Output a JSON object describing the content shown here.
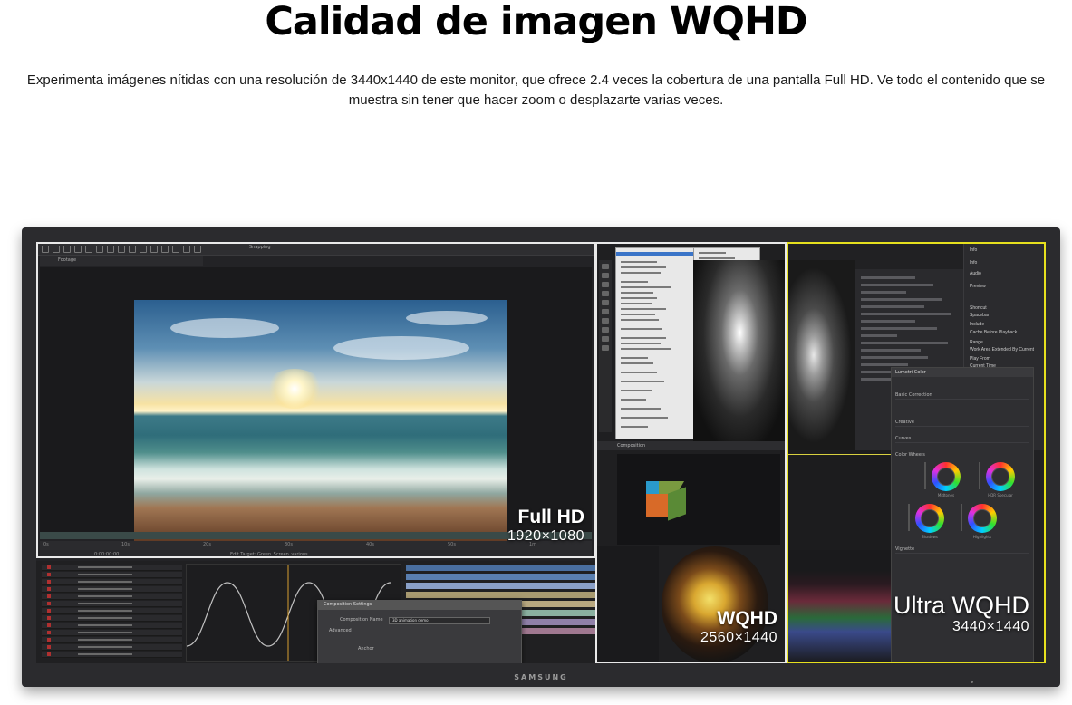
{
  "page": {
    "title": "Calidad de imagen WQHD",
    "description": "Experimenta imágenes nítidas con una resolución de 3440x1440 de este monitor, que ofrece 2.4 veces la cobertura de una pantalla Full HD. Ve todo el contenido que se muestra sin tener que hacer zoom o desplazarte varias veces."
  },
  "monitor": {
    "brand": "SAMSUNG",
    "zones": [
      {
        "name": "Full HD",
        "resolution": "1920×1080",
        "frame_color": "#e9e9e9"
      },
      {
        "name": "WQHD",
        "resolution": "2560×1440",
        "frame_color": "#e9e9e9"
      },
      {
        "name": "Ultra WQHD",
        "resolution": "3440×1440",
        "frame_color": "#e6e01e"
      }
    ]
  },
  "screen_ui": {
    "footage_tab": "Footage",
    "snapping": "Snapping",
    "ruler": [
      "0s",
      "10s",
      "20s",
      "30s",
      "40s",
      "50s",
      "1m"
    ],
    "timecode": "0:00:00:00",
    "edit_target": "Edit Target: Green_Screen_various",
    "composition_tab": "Composition",
    "dialog_title": "Composition Settings",
    "dialog_name_label": "Composition Name",
    "dialog_name_value": "3D animation demo",
    "dialog_advanced": "Advanced",
    "dialog_anchor": "Anchor",
    "info_items": [
      "Info",
      "Info",
      "Audio",
      "Preview",
      "Shortcut",
      "Spacebar",
      "Include",
      "Cache Before Playback",
      "Range",
      "Work Area Extended By Current",
      "Play From",
      "Current Time"
    ],
    "lumetri_title": "Lumetri Color",
    "lumetri_rows": [
      "Basic Correction",
      "Creative",
      "Curves",
      "Color Wheels",
      "Vignette"
    ],
    "wheel_labels": [
      "Midtones",
      "HDR Specular",
      "Shadows",
      "Highlights"
    ]
  }
}
